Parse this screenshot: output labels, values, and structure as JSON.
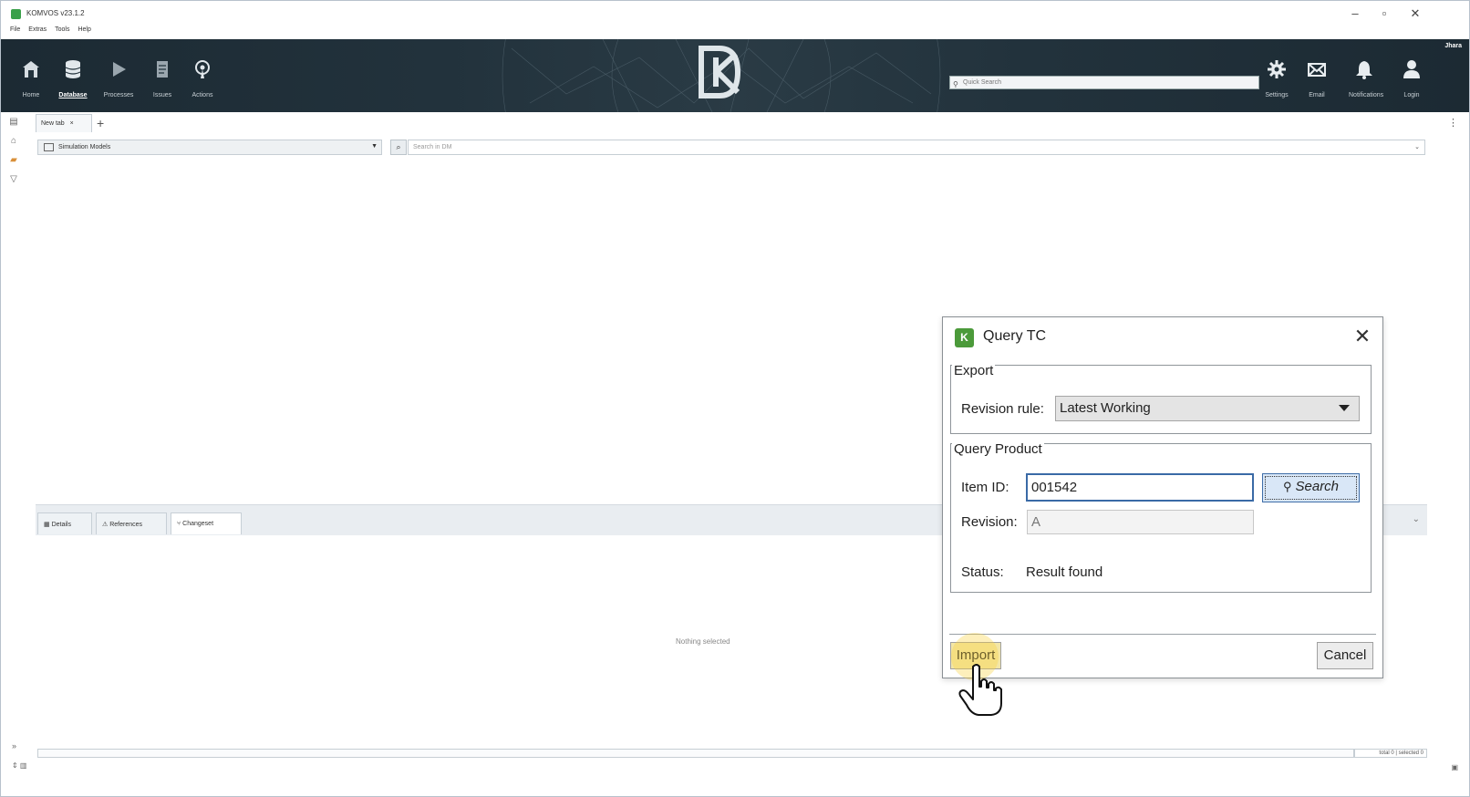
{
  "app": {
    "title": "KOMVOS v23.1.2",
    "menu": [
      "File",
      "Extras",
      "Tools",
      "Help"
    ],
    "window_controls": [
      "–",
      "▫",
      "✕"
    ]
  },
  "toolbar": {
    "buttons": [
      {
        "label": "Home",
        "icon": "home-icon",
        "active": false
      },
      {
        "label": "Database",
        "icon": "database-icon",
        "active": true
      },
      {
        "label": "Processes",
        "icon": "play-icon",
        "active": false
      },
      {
        "label": "Issues",
        "icon": "issues-icon",
        "active": false
      },
      {
        "label": "Actions",
        "icon": "broadcast-icon",
        "active": false
      }
    ],
    "right_buttons": [
      {
        "label": "Settings",
        "icon": "gear-icon"
      },
      {
        "label": "Email",
        "icon": "mail-icon"
      },
      {
        "label": "Notifications",
        "icon": "bell-icon"
      },
      {
        "label": "Login",
        "icon": "user-icon"
      }
    ],
    "quick_search_placeholder": "Quick Search",
    "user": "Jhara"
  },
  "tabs": {
    "doc_tab": "New tab",
    "close": "×",
    "add": "+"
  },
  "selector": {
    "value": "Simulation Models",
    "search_placeholder": "Search in DM"
  },
  "bottom_panel": {
    "tabs": [
      "Details",
      "References",
      "Changeset"
    ],
    "active_tab": "Changeset",
    "empty_message": "Nothing selected",
    "status_right": "total 0 | selected 0"
  },
  "dialog": {
    "title": "Query TC",
    "export_group": "Export",
    "revision_rule_label": "Revision rule:",
    "revision_rule_value": "Latest Working",
    "query_group": "Query Product",
    "item_id_label": "Item ID:",
    "item_id_value": "001542",
    "search_button": "Search",
    "revision_label": "Revision:",
    "revision_value": "A",
    "status_label": "Status:",
    "status_value": "Result found",
    "import_button": "Import",
    "cancel_button": "Cancel"
  },
  "colors": {
    "banner": "#22323c",
    "accent_green": "#4b9a3a",
    "focus_blue": "#3a6aa6",
    "import_highlight": "#f3e6a6"
  }
}
